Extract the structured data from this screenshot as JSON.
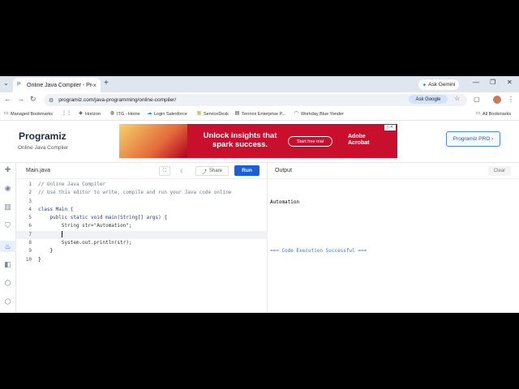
{
  "browser": {
    "tab_title": "Online Java Compiler - Progra...",
    "gemini_label": "Ask Gemini",
    "url": "programiz.com/java-programming/online-compiler/",
    "ask_google_label": "Ask Google",
    "bookmarks": [
      {
        "label": "Managed Bookmarks",
        "icon": "folder-icon"
      },
      {
        "label": "",
        "icon": "grid-icon"
      },
      {
        "label": "Horizon",
        "icon": "horizon-icon"
      },
      {
        "label": "ITG - Home",
        "icon": "globe-icon"
      },
      {
        "label": "Login  Salesforce",
        "icon": "cloud-icon"
      },
      {
        "label": "ServiceDesk",
        "icon": "servicedesk-icon"
      },
      {
        "label": "Terrnox Enterprise P...",
        "icon": "page-icon"
      },
      {
        "label": "Workday Blue Yonder",
        "icon": "workday-icon"
      }
    ],
    "all_bookmarks_label": "All Bookmarks"
  },
  "site": {
    "logo_text": "Programiz",
    "subtitle": "Online Java Compiler",
    "ad": {
      "headline_1": "Unlock insights that",
      "headline_2": "spark success.",
      "cta": "Start free trial",
      "brand_1": "Adobe",
      "brand_2": "Acrobat"
    },
    "pro_button": "Programiz PRO ›"
  },
  "editor": {
    "file_tab": "Main.java",
    "share_label": "Share",
    "run_label": "Run",
    "lines": [
      {
        "num": "1",
        "text": "// Online Java Compiler"
      },
      {
        "num": "2",
        "text": "// Use this editor to write, compile and run your Java code online"
      },
      {
        "num": "3",
        "text": ""
      },
      {
        "num": "4",
        "text": "class Main {"
      },
      {
        "num": "5",
        "text": "    public static void main(String[] args) {"
      },
      {
        "num": "6",
        "text": "        String str=\"Automation\";"
      },
      {
        "num": "7",
        "text": "        "
      },
      {
        "num": "8",
        "text": "        System.out.println(str);"
      },
      {
        "num": "9",
        "text": "    }"
      },
      {
        "num": "10",
        "text": "}"
      }
    ]
  },
  "output": {
    "title": "Output",
    "clear_label": "Clear",
    "lines": [
      "Automation",
      "",
      "=== Code Execution Successful ==="
    ]
  },
  "colors": {
    "run_button": "#1a5fd6",
    "ad_background": "#c8102e",
    "success_text": "#3c78c8"
  }
}
